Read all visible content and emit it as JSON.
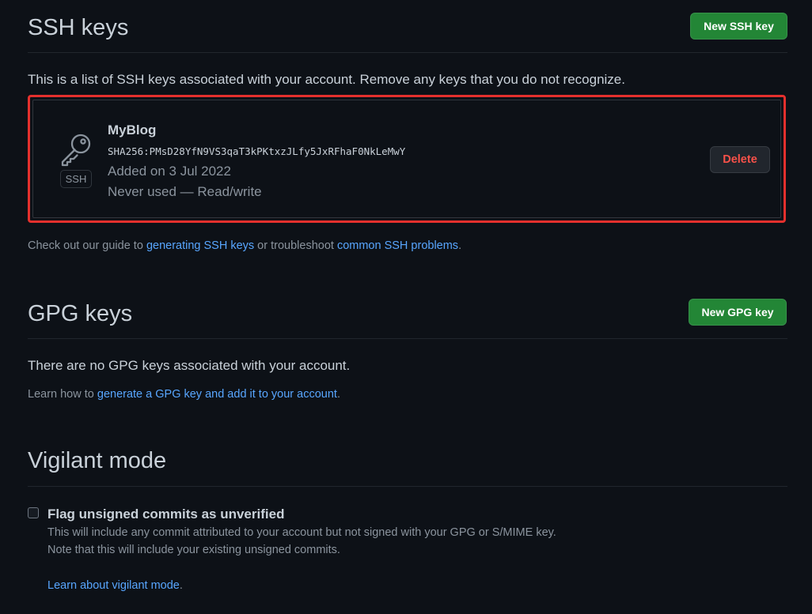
{
  "ssh": {
    "title": "SSH keys",
    "new_button": "New SSH key",
    "description": "This is a list of SSH keys associated with your account. Remove any keys that you do not recognize.",
    "key": {
      "name": "MyBlog",
      "fingerprint": "SHA256:PMsD28YfN9VS3qaT3kPKtxzJLfy5JxRFhaF0NkLeMwY",
      "added": "Added on 3 Jul 2022",
      "usage": "Never used — Read/write",
      "badge": "SSH",
      "icon": "key-icon",
      "delete_label": "Delete"
    },
    "guide": {
      "prefix": "Check out our guide to ",
      "link1": "generating SSH keys",
      "middle": " or troubleshoot ",
      "link2": "common SSH problems",
      "suffix": "."
    }
  },
  "gpg": {
    "title": "GPG keys",
    "new_button": "New GPG key",
    "empty_message": "There are no GPG keys associated with your account.",
    "learn": {
      "prefix": "Learn how to ",
      "link": "generate a GPG key and add it to your account",
      "suffix": "."
    }
  },
  "vigilant": {
    "title": "Vigilant mode",
    "checkbox_label": "Flag unsigned commits as unverified",
    "checked": false,
    "note_line1": "This will include any commit attributed to your account but not signed with your GPG or S/MIME key.",
    "note_line2": "Note that this will include your existing unsigned commits.",
    "learn_link": "Learn about vigilant mode",
    "learn_suffix": "."
  },
  "colors": {
    "background": "#0d1117",
    "primary_button": "#238636",
    "danger": "#f85149",
    "link": "#58a6ff",
    "highlight_border": "#e5302d"
  }
}
